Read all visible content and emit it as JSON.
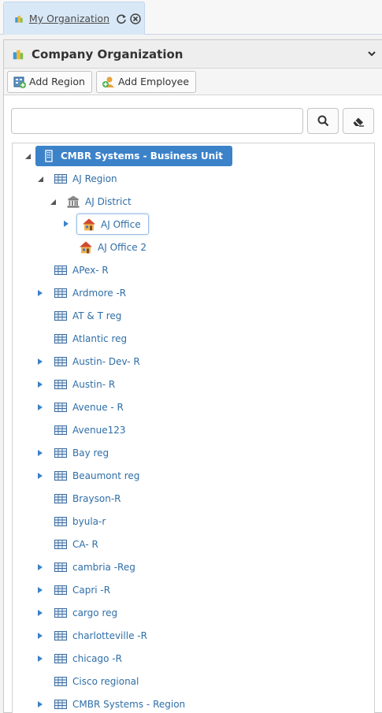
{
  "tab": {
    "title": "My Organization"
  },
  "panel": {
    "title": "Company Organization"
  },
  "toolbar": {
    "add_region": "Add Region",
    "add_employee": "Add Employee"
  },
  "search": {
    "value": "",
    "placeholder": ""
  },
  "tree": {
    "root": "CMBR Systems - Business Unit",
    "aj_region": "AJ Region",
    "aj_district": "AJ District",
    "aj_office": "AJ Office",
    "aj_office_2": "AJ Office 2",
    "regions": [
      "APex- R",
      "Ardmore -R",
      "AT & T reg",
      "Atlantic reg",
      "Austin- Dev- R",
      "Austin- R",
      "Avenue - R",
      "Avenue123",
      "Bay reg",
      "Beaumont reg",
      "Brayson-R",
      "byula-r",
      "CA- R",
      "cambria -Reg",
      "Capri -R",
      "cargo reg",
      "charlotteville -R",
      "chicago -R",
      "Cisco regional",
      "CMBR Systems - Region"
    ],
    "region_expandable": [
      false,
      true,
      false,
      false,
      true,
      true,
      true,
      false,
      true,
      true,
      false,
      false,
      false,
      true,
      true,
      true,
      true,
      true,
      false,
      true
    ]
  },
  "colors": {
    "accent": "#3c82c9",
    "link": "#2f6ea7",
    "tab_bg": "#d9e8f6"
  }
}
